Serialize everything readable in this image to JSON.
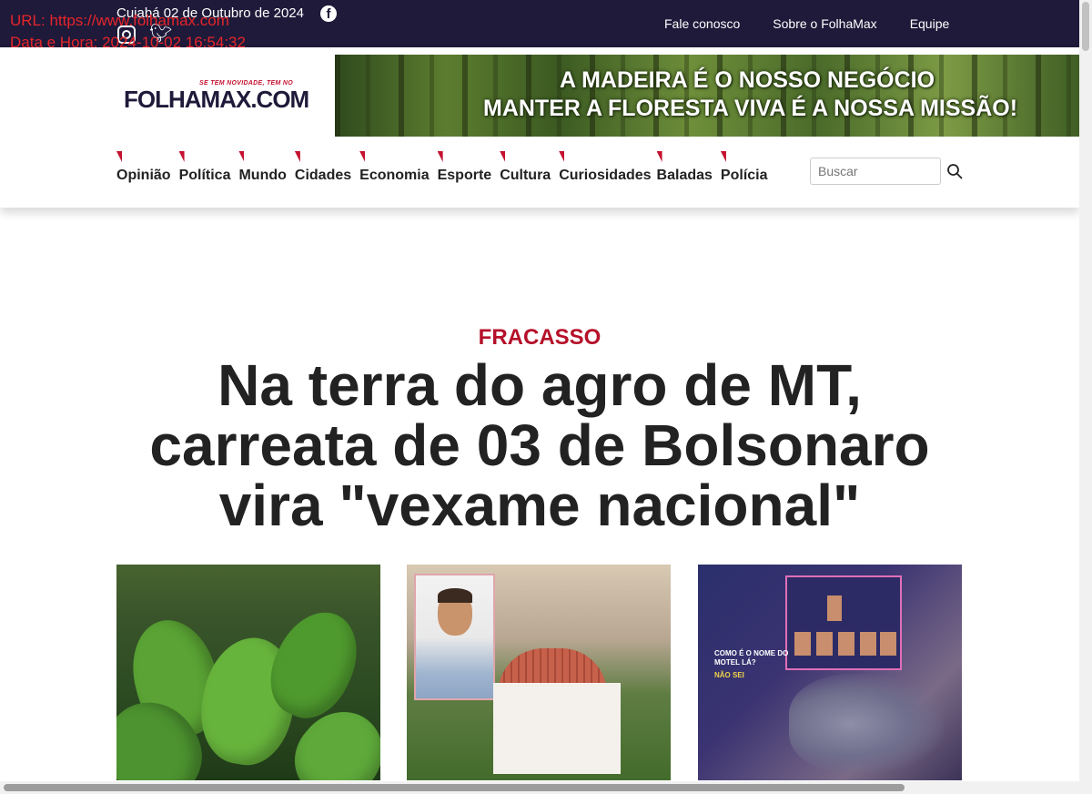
{
  "overlay": {
    "url": "URL: https://www.folhamax.com",
    "datetime": "Data e Hora: 2024-10-02 16:54:32"
  },
  "topbar": {
    "date": "Cuiabá 02 de Outubro de 2024",
    "social_icons": [
      "facebook-icon",
      "instagram-icon",
      "twitter-icon"
    ],
    "links": [
      "Fale conosco",
      "Sobre o FolhaMax",
      "Equipe"
    ]
  },
  "header": {
    "logo_tagline": "SE TEM NOVIDADE, TEM NO",
    "logo_text": "FOLHAMAX.COM",
    "banner_line1": "A MADEIRA É O NOSSO NEGÓCIO",
    "banner_line2": "MANTER A FLORESTA VIVA É A NOSSA MISSÃO!"
  },
  "nav": {
    "items": [
      "Opinião",
      "Política",
      "Mundo",
      "Cidades",
      "Economia",
      "Esporte",
      "Cultura",
      "Curiosidades",
      "Baladas",
      "Polícia"
    ]
  },
  "search": {
    "placeholder": "Buscar"
  },
  "article": {
    "category": "FRACASSO",
    "headline": "Na terra do agro de MT, carreata de 03 de Bolsonaro vira \"vexame nacional\""
  },
  "cards": {
    "card3_text": [
      "COMO É O NOME DO",
      "MOTEL LÁ?",
      "NÃO SEI"
    ]
  },
  "colors": {
    "topbar_bg": "#1f1a3a",
    "accent_red": "#c4122f",
    "overlay_red": "#e5252a"
  }
}
